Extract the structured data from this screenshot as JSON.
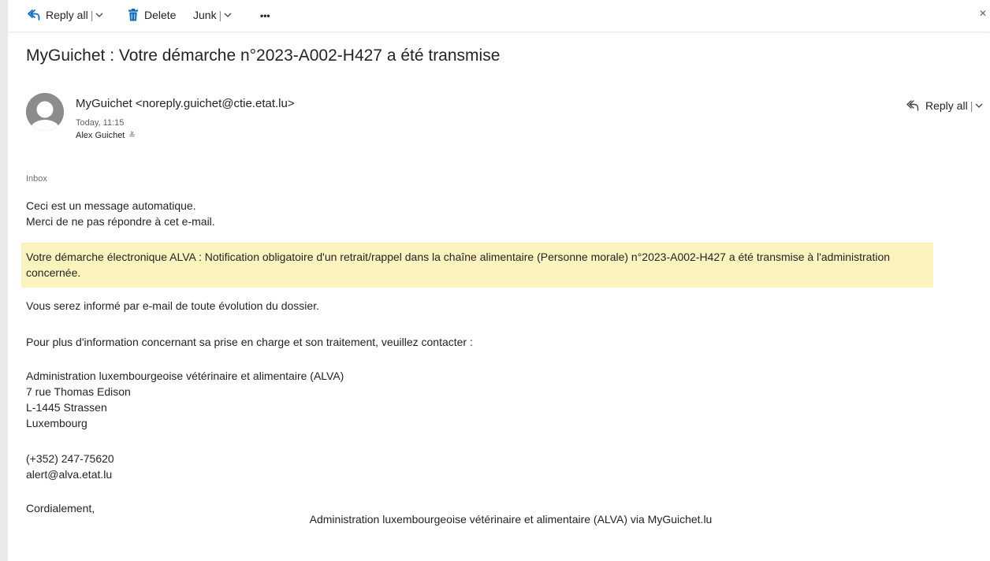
{
  "toolbar": {
    "reply_all_label": "Reply all",
    "delete_label": "Delete",
    "junk_label": "Junk",
    "more_label": "•••",
    "separator": "|"
  },
  "message": {
    "subject": "MyGuichet : Votre démarche n°2023-A002-H427 a été transmise",
    "sender": "MyGuichet <noreply.guichet@ctie.etat.lu>",
    "date": "Today, 11:15",
    "recipient": "Alex Guichet",
    "recipient_expand": "≚",
    "reply_all_label": "Reply all",
    "folder": "Inbox"
  },
  "body": {
    "line1": "Ceci est un message automatique.",
    "line2": "Merci de ne pas répondre à cet e-mail.",
    "highlight": "Votre démarche électronique ALVA : Notification obligatoire d'un retrait/rappel dans la chaîne alimentaire (Personne morale) n°2023-A002-H427 a été transmise à l'administration concernée.",
    "info": "Vous serez informé par e-mail de toute évolution du dossier.",
    "contact_intro": "Pour plus d'information concernant sa prise en charge et son traitement, veuillez contacter :",
    "address": [
      "Administration luxembourgeoise vétérinaire et alimentaire (ALVA)",
      "7 rue Thomas Edison",
      "L-1445 Strassen",
      "Luxembourg"
    ],
    "phone": "(+352) 247-75620",
    "email": "alert@alva.etat.lu",
    "closing": "Cordialement,",
    "footer": "Administration luxembourgeoise vétérinaire et alimentaire (ALVA) via MyGuichet.lu"
  },
  "colors": {
    "accent": "#0f6cbd",
    "highlight_bg": "#fdf3bf",
    "avatar_bg": "#8c8c8c"
  },
  "icons": {
    "reply_all": "reply-all-icon",
    "delete": "trash-icon",
    "chevron": "chevron-down-icon",
    "avatar": "person-icon"
  }
}
